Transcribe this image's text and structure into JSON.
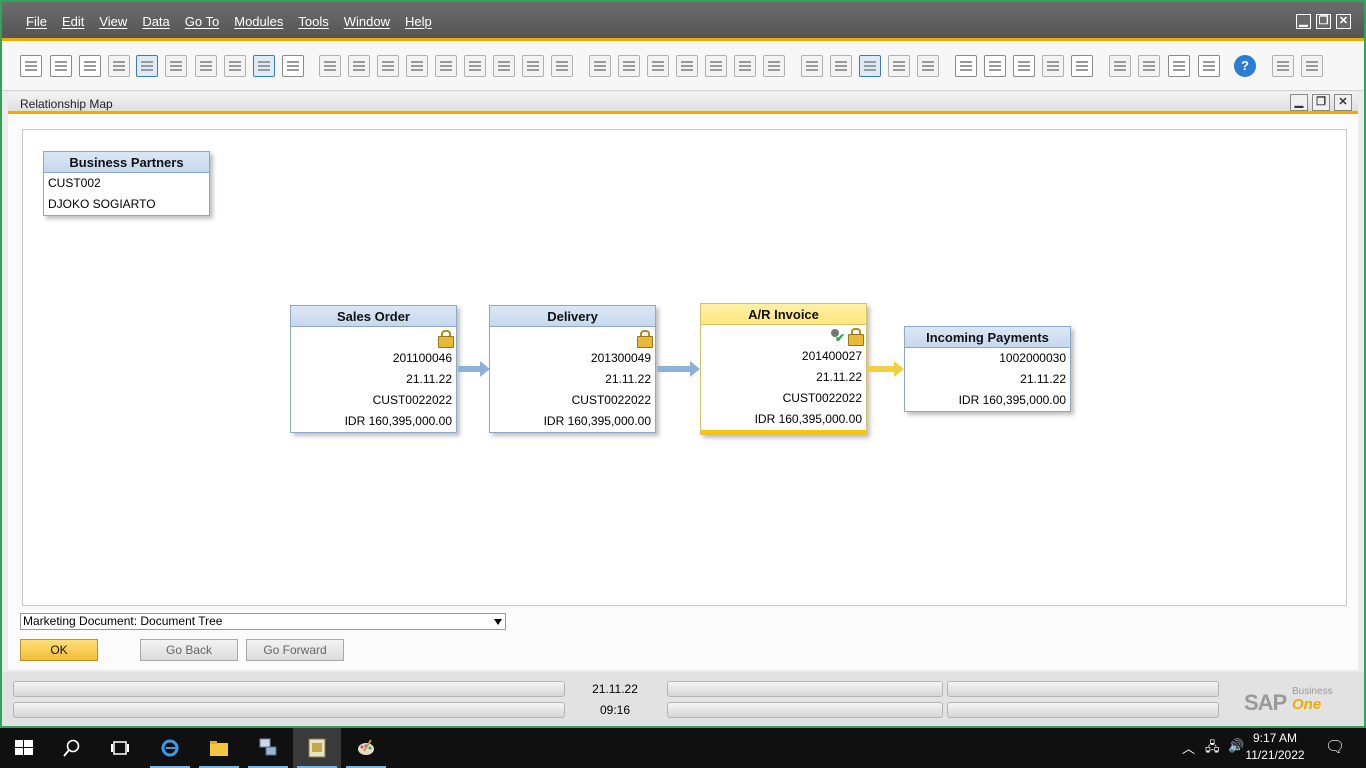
{
  "menubar": {
    "items": [
      "File",
      "Edit",
      "View",
      "Data",
      "Go To",
      "Modules",
      "Tools",
      "Window",
      "Help"
    ],
    "controls": [
      "▁",
      "❐",
      "✕"
    ]
  },
  "toolbar": {
    "icons": [
      "print-preview-icon",
      "print-icon",
      "email-icon",
      "export-icon",
      "fax-icon",
      "excel-icon",
      "word-icon",
      "pdf-icon",
      "move-icon",
      "lock-icon",
      "find-icon",
      "add-icon",
      "first-record-icon",
      "previous-record-icon",
      "next-record-icon",
      "last-record-icon",
      "refresh-icon",
      "filter-icon",
      "sort-icon",
      "base-document-icon",
      "target-document-icon",
      "layout-icon",
      "gross-profit-icon",
      "draw-icon",
      "journal-icon",
      "document-settings-icon",
      "form-settings-icon",
      "message-icon",
      "reply-icon",
      "calendar-icon",
      "mail-icon",
      "alerts-icon",
      "org-icon",
      "user-icon",
      "queries-icon",
      "reports-icon",
      "payment-icon",
      "approval-icon",
      "help-icon",
      "more-1-icon",
      "more-2-icon"
    ],
    "help_glyph": "?"
  },
  "window": {
    "title": "Relationship Map",
    "controls": [
      "▁",
      "❐",
      "✕"
    ]
  },
  "business_partner": {
    "header": "Business Partners",
    "code": "CUST002",
    "name": "DJOKO SOGIARTO"
  },
  "documents": {
    "sales_order": {
      "header": "Sales Order",
      "number": "201100046",
      "date": "21.11.22",
      "customer": "CUST0022022",
      "amount": "IDR 160,395,000.00"
    },
    "delivery": {
      "header": "Delivery",
      "number": "201300049",
      "date": "21.11.22",
      "customer": "CUST0022022",
      "amount": "IDR 160,395,000.00"
    },
    "ar_invoice": {
      "header": "A/R Invoice",
      "number": "201400027",
      "date": "21.11.22",
      "customer": "CUST0022022",
      "amount": "IDR 160,395,000.00"
    },
    "incoming_payments": {
      "header": "Incoming Payments",
      "number": "1002000030",
      "date": "21.11.22",
      "amount": "IDR 160,395,000.00"
    }
  },
  "view_select": {
    "value": "Marketing Document: Document Tree"
  },
  "buttons": {
    "ok": "OK",
    "go_back": "Go Back",
    "go_forward": "Go Forward"
  },
  "statusbar": {
    "date": "21.11.22",
    "time": "09:16"
  },
  "brand": {
    "sap": "SAP",
    "business": "Business",
    "one": "One"
  },
  "taskbar": {
    "time": "9:17 AM",
    "date": "11/21/2022"
  },
  "colors": {
    "accent": "#f0ab00",
    "frame": "#33a457",
    "box_header": "#c6d8ee",
    "active_box": "#ffe77c"
  }
}
